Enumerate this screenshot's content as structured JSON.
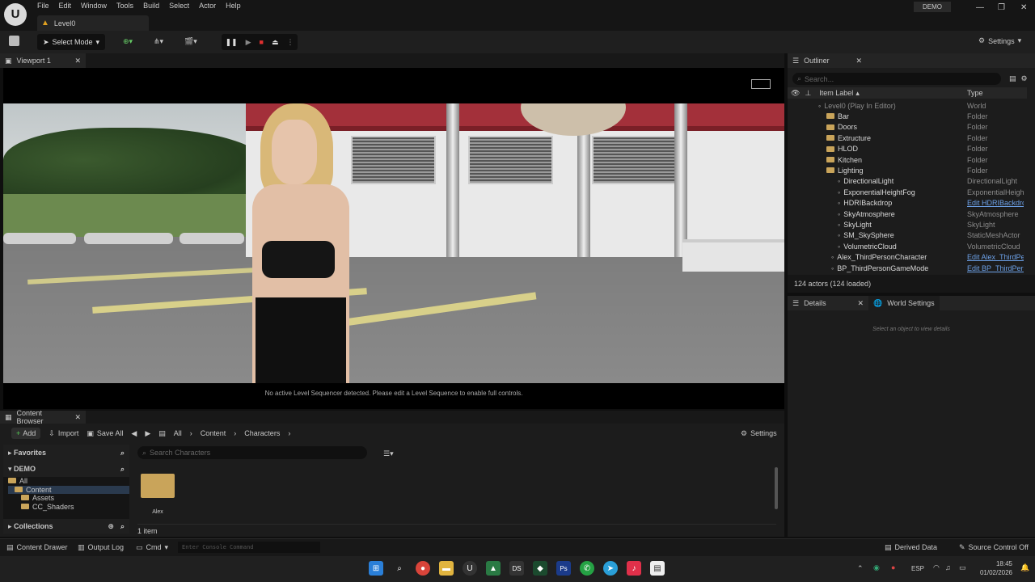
{
  "menu": [
    "File",
    "Edit",
    "Window",
    "Tools",
    "Build",
    "Select",
    "Actor",
    "Help"
  ],
  "level_tab": "Level0",
  "project": "DEMO",
  "toolbar": {
    "select_mode": "Select Mode",
    "settings": "Settings"
  },
  "viewport": {
    "tab": "Viewport 1",
    "message": "No active Level Sequencer detected. Please edit a Level Sequence to enable full controls."
  },
  "outliner": {
    "tab": "Outliner",
    "search_placeholder": "Search...",
    "col_label": "Item Label",
    "col_type": "Type",
    "rows": [
      {
        "label": "Level0 (Play In Editor)",
        "type": "World"
      },
      {
        "label": "Bar",
        "type": "Folder"
      },
      {
        "label": "Doors",
        "type": "Folder"
      },
      {
        "label": "Extructure",
        "type": "Folder"
      },
      {
        "label": "HLOD",
        "type": "Folder"
      },
      {
        "label": "Kitchen",
        "type": "Folder"
      },
      {
        "label": "Lighting",
        "type": "Folder"
      },
      {
        "label": "DirectionalLight",
        "type": "DirectionalLight"
      },
      {
        "label": "ExponentialHeightFog",
        "type": "ExponentialHeight"
      },
      {
        "label": "HDRIBackdrop",
        "type": "Edit HDRIBackdro"
      },
      {
        "label": "SkyAtmosphere",
        "type": "SkyAtmosphere"
      },
      {
        "label": "SkyLight",
        "type": "SkyLight"
      },
      {
        "label": "SM_SkySphere",
        "type": "StaticMeshActor"
      },
      {
        "label": "VolumetricCloud",
        "type": "VolumetricCloud"
      },
      {
        "label": "Alex_ThirdPersonCharacter",
        "type": "Edit Alex_ThirdPer"
      },
      {
        "label": "BP_ThirdPersonGameMode",
        "type": "Edit BP_ThirdPers"
      }
    ],
    "count": "124 actors (124 loaded)"
  },
  "details": {
    "tab": "Details",
    "world_tab": "World Settings",
    "empty": "Select an object to view details"
  },
  "content_browser": {
    "tab": "Content Browser",
    "add": "Add",
    "import": "Import",
    "save_all": "Save All",
    "path": [
      "All",
      "Content",
      "Characters"
    ],
    "settings": "Settings",
    "search_placeholder": "Search Characters",
    "favorites": "Favorites",
    "project": "DEMO",
    "tree": [
      "All",
      "Content",
      "Assets",
      "CC_Shaders"
    ],
    "collections": "Collections",
    "asset": "Alex",
    "item_count": "1 item"
  },
  "status": {
    "content_drawer": "Content Drawer",
    "output_log": "Output Log",
    "cmd": "Cmd",
    "console_placeholder": "Enter Console Command",
    "derived": "Derived Data",
    "source": "Source Control Off"
  },
  "taskbar": {
    "lang": "ESP",
    "time": "18:45",
    "date": "01/02/2026"
  }
}
